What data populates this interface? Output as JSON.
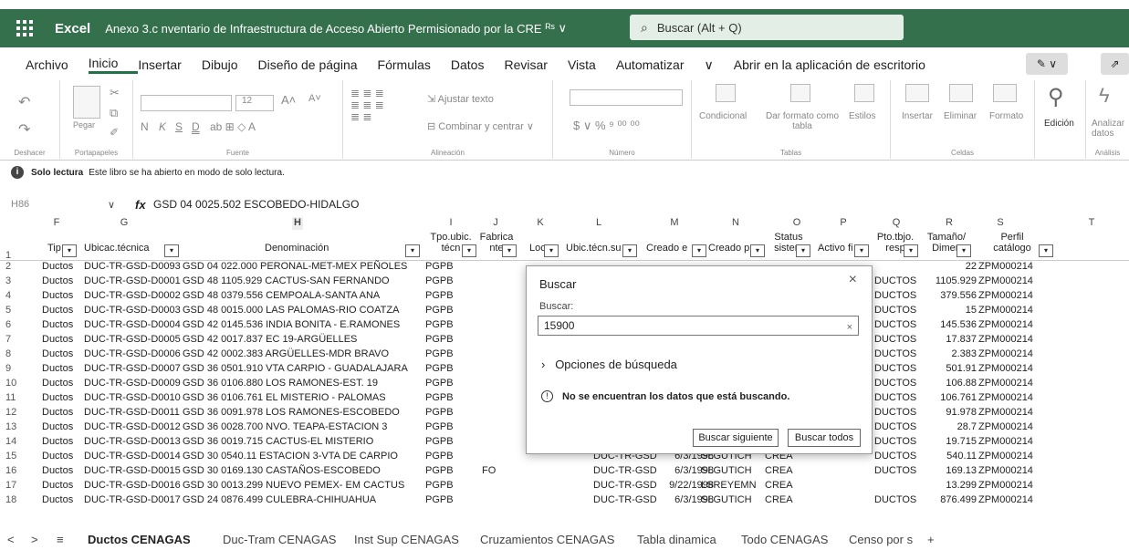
{
  "titlebar": {
    "app": "Excel",
    "document_title": "Anexo 3.c nventario de Infraestructura de Acceso Abierto Permisionado por la CRE",
    "doc_badge": "ᴿˢ ∨",
    "search_placeholder": "Buscar (Alt + Q)"
  },
  "menu": {
    "tabs": [
      "Archivo",
      "Inicio",
      "Insertar",
      "Dibujo",
      "Diseño de página",
      "Fórmulas",
      "Datos",
      "Revisar",
      "Vista",
      "Automatizar",
      "∨",
      "Abrir en la aplicación de escritorio"
    ],
    "active": "Inicio"
  },
  "ribbon": {
    "undo_group": "Deshacer",
    "clipboard_group": "Portapapeles",
    "paste": "Pegar",
    "font_group": "Fuente",
    "font_size": "12",
    "font_letters": [
      "N",
      "K",
      "S",
      "D"
    ],
    "alignment_group": "Alineación",
    "wrap_text": "Ajustar texto",
    "merge_center": "Combinar y centrar",
    "number_group": "Número",
    "number_symbols": "$ ∨ % ⁹ ⁰⁰ ⁰⁰",
    "styles": [
      "Condicional",
      "Dar formato como tabla",
      "Estilos"
    ],
    "styles_group": "Tablas",
    "cells": [
      "Insertar",
      "Eliminar",
      "Formato"
    ],
    "cells_group": "Celdas",
    "edit": "Edición",
    "analyze": "Analizar datos",
    "analysis_group": "Análisis"
  },
  "info": {
    "label": "Solo lectura",
    "text": "Este libro se ha abierto en modo de solo lectura."
  },
  "formula": {
    "cell_ref": "H86",
    "fx": "fx",
    "value": "GSD 04 0025.502 ESCOBEDO-HIDALGO"
  },
  "columns": [
    "F",
    "G",
    "H",
    "I",
    "J",
    "K",
    "L",
    "M",
    "N",
    "O",
    "P",
    "Q",
    "R",
    "S",
    "T"
  ],
  "headers": {
    "tip": "Tip",
    "ubic": "Ubicac.técnica",
    "denom": "Denominación",
    "tpo": "Tpo.ubic. técn",
    "fab": "Fabrica nte",
    "loc": "Loc",
    "ubic_sup": "Ubic.técn.su",
    "creado_el": "Creado e",
    "creado_p": "Creado p",
    "status": "Status sistem",
    "activo": "Activo fi",
    "pto": "Pto.tbjo. resp",
    "tam": "Tamaño/ Dimen",
    "perfil": "Perfil catálogo"
  },
  "rows": [
    {
      "n": "1"
    },
    {
      "n": "2",
      "f": "Ductos",
      "g": "DUC-TR-GSD-D0093",
      "h": "GSD 04 022.000 PERONAL-MET-MEX PEÑOLES",
      "i": "PGPB",
      "r": "22",
      "s": "ZPM000214"
    },
    {
      "n": "3",
      "f": "Ductos",
      "g": "DUC-TR-GSD-D0001",
      "h": "GSD 48 1105.929 CACTUS-SAN FERNANDO",
      "i": "PGPB",
      "q": "DUCTOS",
      "r": "1105.929",
      "s": "ZPM000214"
    },
    {
      "n": "4",
      "f": "Ductos",
      "g": "DUC-TR-GSD-D0002",
      "h": "GSD 48 0379.556 CEMPOALA-SANTA ANA",
      "i": "PGPB",
      "q": "DUCTOS",
      "r": "379.556",
      "s": "ZPM000214"
    },
    {
      "n": "5",
      "f": "Ductos",
      "g": "DUC-TR-GSD-D0003",
      "h": "GSD 48 0015.000 LAS PALOMAS-RIO COATZA",
      "i": "PGPB",
      "q": "DUCTOS",
      "r": "15",
      "s": "ZPM000214"
    },
    {
      "n": "6",
      "f": "Ductos",
      "g": "DUC-TR-GSD-D0004",
      "h": "GSD 42 0145.536 INDIA BONITA - E.RAMONES",
      "i": "PGPB",
      "q": "DUCTOS",
      "r": "145.536",
      "s": "ZPM000214"
    },
    {
      "n": "7",
      "f": "Ductos",
      "g": "DUC-TR-GSD-D0005",
      "h": "GSD 42 0017.837 EC 19-ARGÜELLES",
      "i": "PGPB",
      "q": "DUCTOS",
      "r": "17.837",
      "s": "ZPM000214"
    },
    {
      "n": "8",
      "f": "Ductos",
      "g": "DUC-TR-GSD-D0006",
      "h": "GSD 42 0002.383 ARGÜELLES-MDR BRAVO",
      "i": "PGPB",
      "q": "DUCTOS",
      "r": "2.383",
      "s": "ZPM000214"
    },
    {
      "n": "9",
      "f": "Ductos",
      "g": "DUC-TR-GSD-D0007",
      "h": "GSD 36 0501.910 VTA CARPIO - GUADALAJARA",
      "i": "PGPB",
      "q": "DUCTOS",
      "r": "501.91",
      "s": "ZPM000214"
    },
    {
      "n": "10",
      "f": "Ductos",
      "g": "DUC-TR-GSD-D0009",
      "h": "GSD 36 0106.880 LOS RAMONES-EST. 19",
      "i": "PGPB",
      "q": "DUCTOS",
      "r": "106.88",
      "s": "ZPM000214"
    },
    {
      "n": "11",
      "f": "Ductos",
      "g": "DUC-TR-GSD-D0010",
      "h": "GSD 36 0106.761 EL MISTERIO - PALOMAS",
      "i": "PGPB",
      "q": "DUCTOS",
      "r": "106.761",
      "s": "ZPM000214"
    },
    {
      "n": "12",
      "f": "Ductos",
      "g": "DUC-TR-GSD-D0011",
      "h": "GSD 36 0091.978 LOS RAMONES-ESCOBEDO",
      "i": "PGPB",
      "q": "DUCTOS",
      "r": "91.978",
      "s": "ZPM000214"
    },
    {
      "n": "13",
      "f": "Ductos",
      "g": "DUC-TR-GSD-D0012",
      "h": "GSD 36 0028.700 NVO. TEAPA-ESTACION 3",
      "i": "PGPB",
      "q": "DUCTOS",
      "r": "28.7",
      "s": "ZPM000214"
    },
    {
      "n": "14",
      "f": "Ductos",
      "g": "DUC-TR-GSD-D0013",
      "h": "GSD 36 0019.715 CACTUS-EL MISTERIO",
      "i": "PGPB",
      "q": "DUCTOS",
      "r": "19.715",
      "s": "ZPM000214"
    },
    {
      "n": "15",
      "f": "Ductos",
      "g": "DUC-TR-GSD-D0014",
      "h": "GSD 30 0540.11 ESTACION 3-VTA DE CARPIO",
      "i": "PGPB",
      "l": "DUC-TR-GSD",
      "m": "6/3/1998",
      "n2": "SLGUTICH",
      "o": "CREA",
      "q": "DUCTOS",
      "r": "540.11",
      "s": "ZPM000214"
    },
    {
      "n": "16",
      "f": "Ductos",
      "g": "DUC-TR-GSD-D0015",
      "h": "GSD 30 0169.130 CASTAÑOS-ESCOBEDO",
      "i": "PGPB",
      "j": "FO",
      "l": "DUC-TR-GSD",
      "m": "6/3/1998",
      "n2": "SLGUTICH",
      "o": "CREA",
      "q": "DUCTOS",
      "r": "169.13",
      "s": "ZPM000214"
    },
    {
      "n": "17",
      "f": "Ductos",
      "g": "DUC-TR-GSD-D0016",
      "h": "GSD 30 0013.299 NUEVO PEMEX- EM CACTUS",
      "i": "PGPB",
      "l": "DUC-TR-GSD",
      "m": "9/22/1998",
      "n2": "LSREYEMN",
      "o": "CREA",
      "r": "13.299",
      "s": "ZPM000214"
    },
    {
      "n": "18",
      "f": "Ductos",
      "g": "DUC-TR-GSD-D0017",
      "h": "GSD 24 0876.499 CULEBRA-CHIHUAHUA",
      "i": "PGPB",
      "l": "DUC-TR-GSD",
      "m": "6/3/1998",
      "n2": "SLGUTICH",
      "o": "CREA",
      "q": "DUCTOS",
      "r": "876.499",
      "s": "ZPM000214"
    }
  ],
  "dialog": {
    "title": "Buscar",
    "close": "×",
    "label": "Buscar:",
    "value": "15900",
    "clear": "×",
    "options": "Opciones de búsqueda",
    "message": "No se encuentran los datos que está buscando.",
    "find_next": "Buscar siguiente",
    "find_all": "Buscar todos"
  },
  "sheets": {
    "nav_prev": "<",
    "nav_next": ">",
    "menu": "≡",
    "tabs": [
      "Ductos CENAGAS",
      "Duc-Tram CENAGAS",
      "Inst Sup CENAGAS",
      "Cruzamientos CENAGAS",
      "Tabla dinamica",
      "Todo CENAGAS",
      "Censo por s"
    ],
    "add": "+",
    "active": "Ductos CENAGAS"
  },
  "colors": {
    "title_bg": "#34704c",
    "accent": "#217346"
  }
}
